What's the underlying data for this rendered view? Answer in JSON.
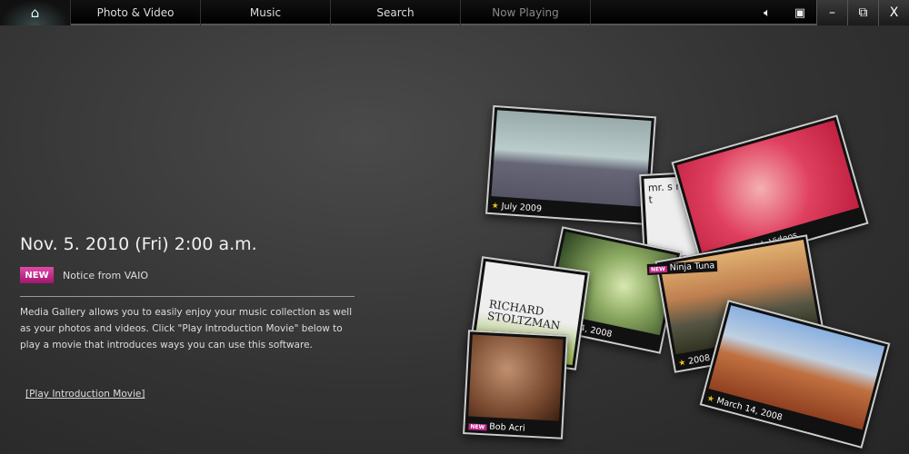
{
  "nav": {
    "home_icon": "home-icon",
    "tabs": [
      "Photo & Video",
      "Music",
      "Search",
      "Now Playing"
    ],
    "active_dim": "Now Playing"
  },
  "controls": {
    "volume_icon": "speaker-icon",
    "tools_icon": "toolbox-icon",
    "minimize": "–",
    "restore": "⧉",
    "close": "X"
  },
  "notice": {
    "date": "Nov. 5. 2010 (Fri) 2:00 a.m.",
    "badge": "NEW",
    "title": "Notice from VAIO",
    "body": "Media Gallery allows you to easily enjoy your music collection as well as your photos and videos. Click \"Play Introduction Movie\" below to play a movie that introduces ways you can use this software.",
    "link": "[Play Introduction Movie]",
    "badge_color": "#c0278a"
  },
  "gallery": [
    {
      "caption": "July 2009",
      "new": false
    },
    {
      "caption": "Ninja Tuna",
      "new": true,
      "art_text": "mr. s ninja t"
    },
    {
      "caption": "Popular Web Videos",
      "new": false
    },
    {
      "caption": "4, 2008",
      "new": false
    },
    {
      "caption": "RICHARD STOLTZMAN",
      "new": false,
      "album": true
    },
    {
      "caption": "2008",
      "new": false
    },
    {
      "caption": "March 14, 2008",
      "new": false
    },
    {
      "caption": "Bob Acri",
      "new": true
    }
  ]
}
